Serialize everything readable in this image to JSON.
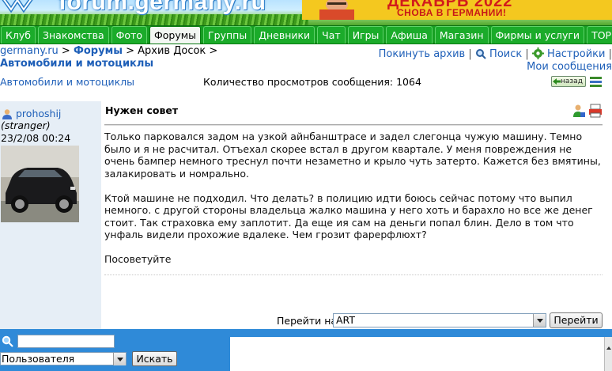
{
  "banner": {
    "logo_text": "forum.germany.ru",
    "promo_top": "ДЕКАБРЬ 2022",
    "promo_sub": "СНОВА В ГЕРМАНИИ!"
  },
  "nav": {
    "tabs": [
      {
        "label": "Клуб"
      },
      {
        "label": "Знакомства"
      },
      {
        "label": "Фото"
      },
      {
        "label": "Форумы",
        "active": true
      },
      {
        "label": "Группы"
      },
      {
        "label": "Дневники"
      },
      {
        "label": "Чат"
      },
      {
        "label": "Игры"
      },
      {
        "label": "Афиша"
      },
      {
        "label": "Магазин"
      },
      {
        "label": "Фирмы и услуги"
      },
      {
        "label": "TOP"
      }
    ]
  },
  "breadcrumb": {
    "site": "germany.ru",
    "sep1": " > ",
    "forums": "Форумы",
    "sep2": " > Архив Досок > ",
    "current": "Автомобили и мотоциклы"
  },
  "toplinks": {
    "leave_archive": "Покинуть архив",
    "search": "Поиск",
    "settings": "Настройки",
    "my_messages": "Мои сообщения"
  },
  "subrow": {
    "forum_name": "Автомобили и мотоциклы",
    "views": "Количество просмотров сообщения: 1064",
    "back_label": "назад"
  },
  "post": {
    "author": "prohoshij",
    "status": "(stranger)",
    "date": "23/2/08 00:24",
    "title": "Нужен совет",
    "paragraphs": [
      "Только парковался задом на узкой айнбанштрасе и задел слегонца чужую машину. Темно было и я не расчитал. Отъехал скорее встал в другом квартале. У меня повреждения не очень бампер немного треснул почти незаметно и крыло чуть затерто. Кажется без вмятины, залакировать и номрально.",
      "Ктой машине не подходил. Что делать? в полицию идти боюсь сейчас потому что выпил немного. с другой стороны владельца жалко машина у него хоть и барахло но все же денег стоит. Так страховка ему заплотит. Да еще ия сам на деньги попал блин. Дело в том что унфаль видели прохожие вдалеке. Чем грозит фарерфлюхт?",
      "Посоветуйте"
    ]
  },
  "jump": {
    "label": "Перейти на",
    "selected": "ART",
    "button": "Перейти"
  },
  "footer": {
    "search_placeholder": "",
    "scope_selected": "Пользователя",
    "search_button": "Искать"
  },
  "colors": {
    "nav_green": "#169e22",
    "link_blue": "#1e5fb8",
    "footer_blue": "#2f8ad8",
    "author_bg": "#e6eef6"
  }
}
